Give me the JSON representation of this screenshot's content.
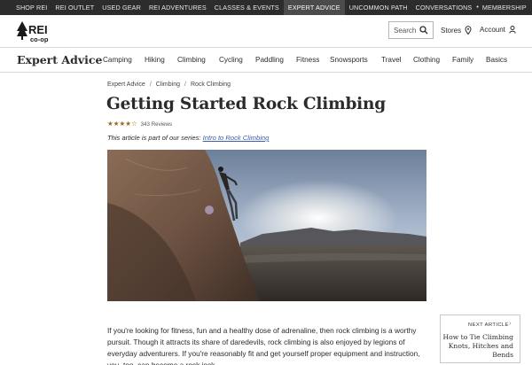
{
  "topbar": {
    "items": [
      "SHOP REI",
      "REI OUTLET",
      "USED GEAR",
      "REI ADVENTURES",
      "CLASSES & EVENTS",
      "EXPERT ADVICE",
      "UNCOMMON PATH",
      "CONVERSATIONS",
      "MEMBERSHIP"
    ],
    "active": "EXPERT ADVICE",
    "bg_color": "#2c2c2c"
  },
  "header": {
    "logo_top": "REI",
    "logo_bottom": "co-op",
    "search_placeholder": "Search",
    "stores_label": "Stores",
    "account_label": "Account"
  },
  "nav": {
    "section_title": "Expert Advice",
    "categories": [
      "Camping",
      "Hiking",
      "Climbing",
      "Cycling",
      "Paddling",
      "Fitness",
      "Snowsports",
      "Travel",
      "Clothing",
      "Family",
      "Basics"
    ]
  },
  "breadcrumb": [
    "Expert Advice",
    "Climbing",
    "Rock Climbing"
  ],
  "article": {
    "title": "Getting Started Rock Climbing",
    "rating": 4.5,
    "reviews": "343 Reviews",
    "series_prefix": "This article is part of our series:",
    "series_link": "Intro to Rock Climbing",
    "intro": "If you're looking for fitness, fun and a healthy dose of adrenaline, then rock climbing is a worthy pursuit. Though it attracts its share of daredevils, rock climbing is also enjoyed by legions of everyday adventurers. If you're reasonably fit and get yourself proper equipment and instruction, you, too, can become a rock jock."
  },
  "next_article": {
    "label": "NEXT ARTICLE",
    "title": "How to Tie Climbing Knots, Hitches and Bends"
  },
  "colors": {
    "link": "#3d5ea8",
    "star": "#9a6a15",
    "text": "#2b2b2b"
  }
}
